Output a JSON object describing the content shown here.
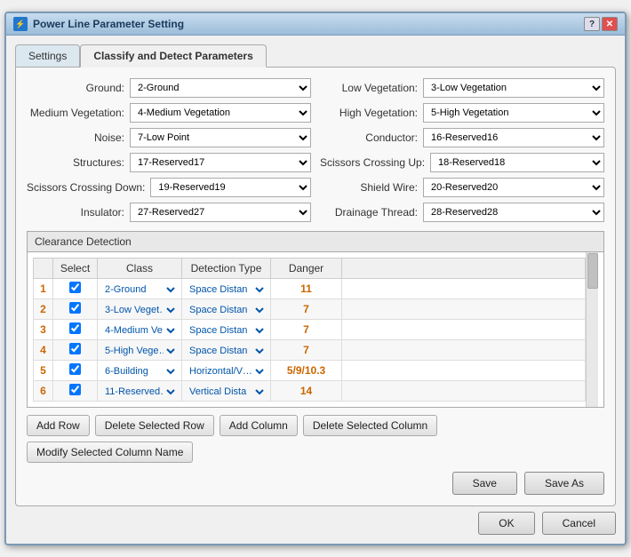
{
  "window": {
    "title": "Power Line Parameter Setting",
    "icon": "⚡"
  },
  "tabs": {
    "settings": "Settings",
    "classify": "Classify and Detect Parameters"
  },
  "form": {
    "ground_label": "Ground:",
    "ground_value": "2-Ground",
    "low_veg_label": "Low Vegetation:",
    "low_veg_value": "3-Low Vegetation",
    "med_veg_label": "Medium Vegetation:",
    "med_veg_value": "4-Medium Vegetation",
    "high_veg_label": "High Vegetation:",
    "high_veg_value": "5-High Vegetation",
    "noise_label": "Noise:",
    "noise_value": "7-Low Point",
    "conductor_label": "Conductor:",
    "conductor_value": "16-Reserved16",
    "structures_label": "Structures:",
    "structures_value": "17-Reserved17",
    "scissors_up_label": "Scissors Crossing Up:",
    "scissors_up_value": "18-Reserved18",
    "scissors_down_label": "Scissors Crossing Down:",
    "scissors_down_value": "19-Reserved19",
    "shield_wire_label": "Shield Wire:",
    "shield_wire_value": "20-Reserved20",
    "insulator_label": "Insulator:",
    "insulator_value": "27-Reserved27",
    "drainage_label": "Drainage Thread:",
    "drainage_value": "28-Reserved28"
  },
  "clearance": {
    "section_title": "Clearance Detection",
    "table": {
      "headers": [
        "",
        "Select",
        "Class",
        "Detection Type",
        "Danger",
        ""
      ],
      "rows": [
        {
          "num": "1",
          "checked": true,
          "class": "2-Ground",
          "detection": "Space Distan",
          "danger": "11"
        },
        {
          "num": "2",
          "checked": true,
          "class": "3-Low Veget…",
          "detection": "Space Distan",
          "danger": "7"
        },
        {
          "num": "3",
          "checked": true,
          "class": "4-Medium Ve…",
          "detection": "Space Distan",
          "danger": "7"
        },
        {
          "num": "4",
          "checked": true,
          "class": "5-High Vege…",
          "detection": "Space Distan",
          "danger": "7"
        },
        {
          "num": "5",
          "checked": true,
          "class": "6-Building",
          "detection": "Horizontal/V…",
          "danger": "5/9/10.3"
        },
        {
          "num": "6",
          "checked": true,
          "class": "11-Reserved…",
          "detection": "Vertical Dista",
          "danger": "14"
        }
      ]
    }
  },
  "buttons": {
    "add_row": "Add Row",
    "delete_row": "Delete Selected Row",
    "add_column": "Add Column",
    "delete_column": "Delete Selected Column",
    "modify_column": "Modify Selected Column Name",
    "save": "Save",
    "save_as": "Save As",
    "ok": "OK",
    "cancel": "Cancel"
  }
}
